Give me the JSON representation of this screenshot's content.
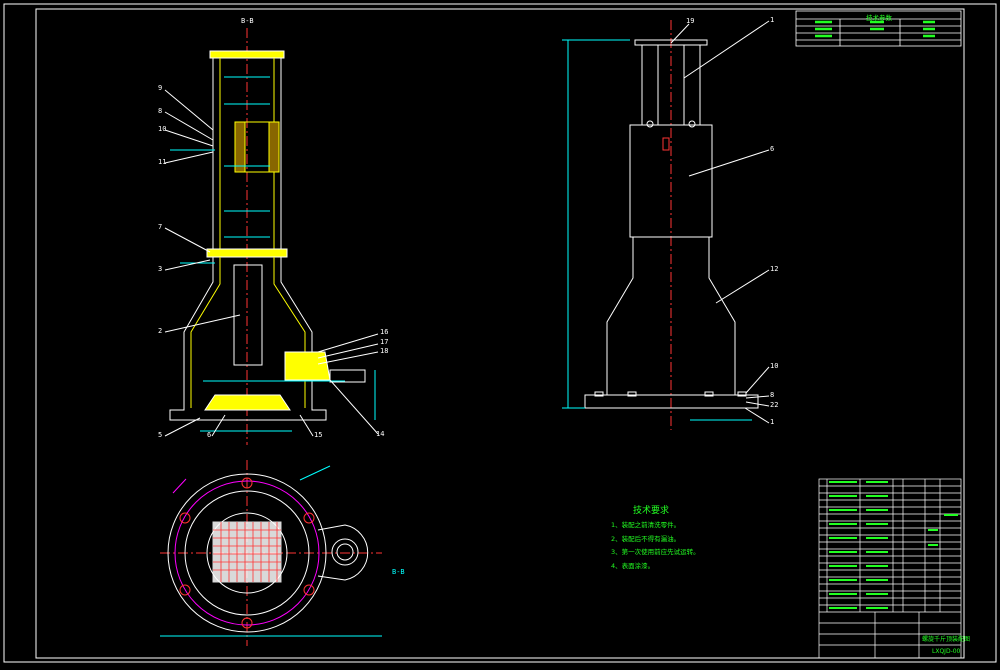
{
  "section_mark": "B-B",
  "section_mark_2": "B-B",
  "part_callouts_left": [
    "9",
    "8",
    "10",
    "11",
    "7",
    "3",
    "2",
    "5",
    "6",
    "15",
    "16",
    "17",
    "18",
    "14"
  ],
  "part_callouts_right": [
    "19",
    "1",
    "6",
    "12",
    "10",
    "8",
    "22",
    "1"
  ],
  "tech_requirements": {
    "title": "技术要求",
    "items": [
      "1、装配之前清洗零件。",
      "2、装配后不得有漏油。",
      "3、第一次使用前应先试运转。",
      "4、表面涂漆。"
    ]
  },
  "spec_table_title": "技术参数",
  "title_block": {
    "drawing_name": "螺旋千斤顶装配图",
    "drawing_no": "LXQJD-00"
  },
  "colors": {
    "background": "#000000",
    "lines": "#ffffff",
    "hatch": "#ffff00",
    "dimension": "#00ffff",
    "centerline": "#ff3333",
    "text_green": "#22ff22",
    "accent_magenta": "#ff00ff"
  }
}
